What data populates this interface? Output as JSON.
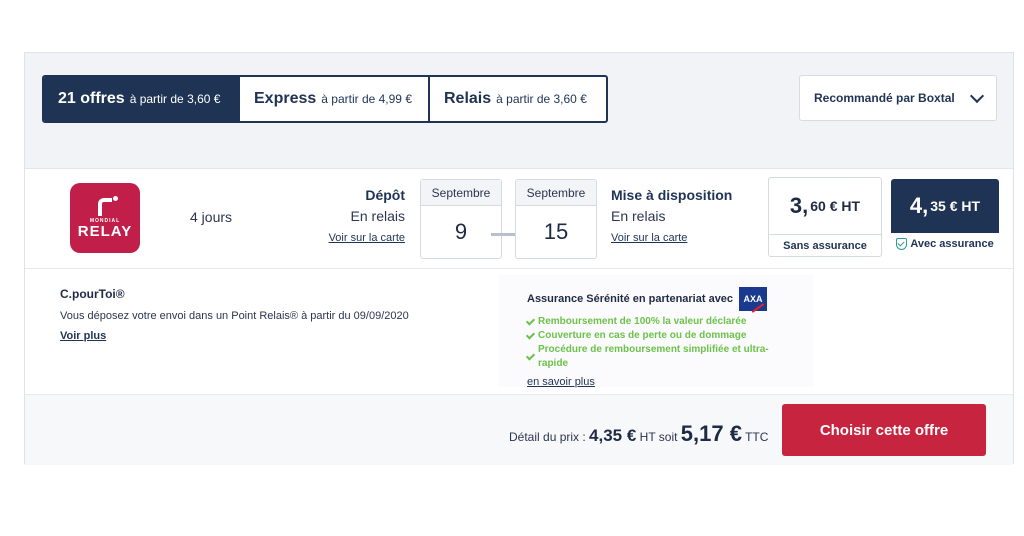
{
  "tabs": [
    {
      "bold": "21 offres",
      "small": "à partir de 3,60 €"
    },
    {
      "bold": "Express",
      "small": "à partir de 4,99 €"
    },
    {
      "bold": "Relais",
      "small": "à partir de 3,60 €"
    }
  ],
  "sort": {
    "label": "Recommandé par Boxtal"
  },
  "offer": {
    "carrier_logo": {
      "line1": "MONDIAL",
      "line2": "RELAY"
    },
    "duration": "4 jours",
    "depot": {
      "title": "Dépôt",
      "sub": "En relais",
      "link": "Voir sur la carte"
    },
    "date_from": {
      "month": "Septembre",
      "day": "9"
    },
    "date_to": {
      "month": "Septembre",
      "day": "15"
    },
    "dispo": {
      "title": "Mise à disposition",
      "sub": "En relais",
      "link": "Voir sur la carte"
    },
    "price_no_ins": {
      "big": "3,",
      "rest": "60 € HT",
      "label": "Sans assurance"
    },
    "price_ins": {
      "big": "4,",
      "rest": "35 € HT",
      "label": "Avec assurance"
    },
    "service": {
      "title": "C.pourToi®",
      "desc": "Vous déposez votre envoi dans un Point Relais® à partir du 09/09/2020",
      "link": "Voir plus"
    },
    "insurance": {
      "title": "Assurance Sérénité en partenariat avec",
      "brand": "AXA",
      "items": [
        "Remboursement de 100% la valeur déclarée",
        "Couverture en cas de perte ou de dommage",
        "Procédure de remboursement simplifiée et ultra-rapide"
      ],
      "link": "en savoir plus"
    },
    "detail": {
      "prefix": "Détail du prix :",
      "ht_big": "4,35 €",
      "ht_suffix": "HT soit",
      "ttc_big": "5,17 €",
      "ttc_suffix": "TTC"
    },
    "cta": "Choisir cette offre"
  },
  "colors": {
    "navy": "#1f3354",
    "cta": "#c7243f",
    "brand": "#c21e4a",
    "check": "#6cc24a"
  }
}
